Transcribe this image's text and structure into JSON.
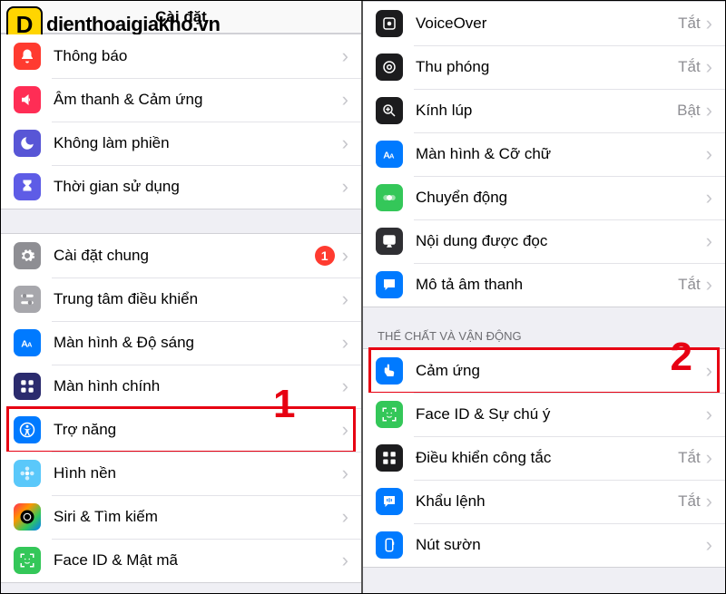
{
  "brand_text": "dienthoaigiakho.vn",
  "brand_letter": "D",
  "left": {
    "title": "Cài đặt",
    "step": "1",
    "groups": [
      {
        "rows": [
          {
            "icon": "bell-icon",
            "color": "c-red",
            "label": "Thông báo"
          },
          {
            "icon": "speaker-icon",
            "color": "c-red2",
            "label": "Âm thanh & Cảm ứng"
          },
          {
            "icon": "moon-icon",
            "color": "c-purple",
            "label": "Không làm phiền"
          },
          {
            "icon": "hourglass-icon",
            "color": "c-indigo",
            "label": "Thời gian sử dụng"
          }
        ]
      },
      {
        "rows": [
          {
            "icon": "gear-icon",
            "color": "c-gray",
            "label": "Cài đặt chung",
            "badge": "1"
          },
          {
            "icon": "switches-icon",
            "color": "c-graylight",
            "label": "Trung tâm điều khiển"
          },
          {
            "icon": "textsize-icon",
            "color": "c-blue",
            "label": "Màn hình & Độ sáng"
          },
          {
            "icon": "apps-icon",
            "color": "c-darkblue",
            "label": "Màn hình chính"
          },
          {
            "icon": "accessibility-icon",
            "color": "c-blue",
            "label": "Trợ năng",
            "highlight": true
          },
          {
            "icon": "flower-icon",
            "color": "c-teal",
            "label": "Hình nền"
          },
          {
            "icon": "siri-icon",
            "color": "c-multi",
            "label": "Siri & Tìm kiếm"
          },
          {
            "icon": "faceid-icon",
            "color": "c-green",
            "label": "Face ID & Mật mã"
          }
        ]
      }
    ]
  },
  "right": {
    "step": "2",
    "section_title": "THỂ CHẤT VÀ VẬN ĐỘNG",
    "groups": [
      {
        "rows": [
          {
            "icon": "voiceover-icon",
            "color": "c-black",
            "label": "VoiceOver",
            "value": "Tắt"
          },
          {
            "icon": "zoom-icon",
            "color": "c-black",
            "label": "Thu phóng",
            "value": "Tắt"
          },
          {
            "icon": "magnifier-icon",
            "color": "c-black",
            "label": "Kính lúp",
            "value": "Bật"
          },
          {
            "icon": "textsize-icon",
            "color": "c-blue",
            "label": "Màn hình & Cỡ chữ"
          },
          {
            "icon": "motion-icon",
            "color": "c-green",
            "label": "Chuyển động"
          },
          {
            "icon": "speech-icon",
            "color": "c-darkgray2",
            "label": "Nội dung được đọc"
          },
          {
            "icon": "bubble-icon",
            "color": "c-blue",
            "label": "Mô tả âm thanh",
            "value": "Tắt"
          }
        ]
      },
      {
        "rows": [
          {
            "icon": "touch-icon",
            "color": "c-blue",
            "label": "Cảm ứng",
            "highlight": true
          },
          {
            "icon": "faceid-icon",
            "color": "c-green",
            "label": "Face ID & Sự chú ý"
          },
          {
            "icon": "switchctrl-icon",
            "color": "c-black",
            "label": "Điều khiển công tắc",
            "value": "Tắt"
          },
          {
            "icon": "voicectrl-icon",
            "color": "c-blue",
            "label": "Khẩu lệnh",
            "value": "Tắt"
          },
          {
            "icon": "side-icon",
            "color": "c-blue",
            "label": "Nút sườn"
          }
        ]
      }
    ]
  }
}
